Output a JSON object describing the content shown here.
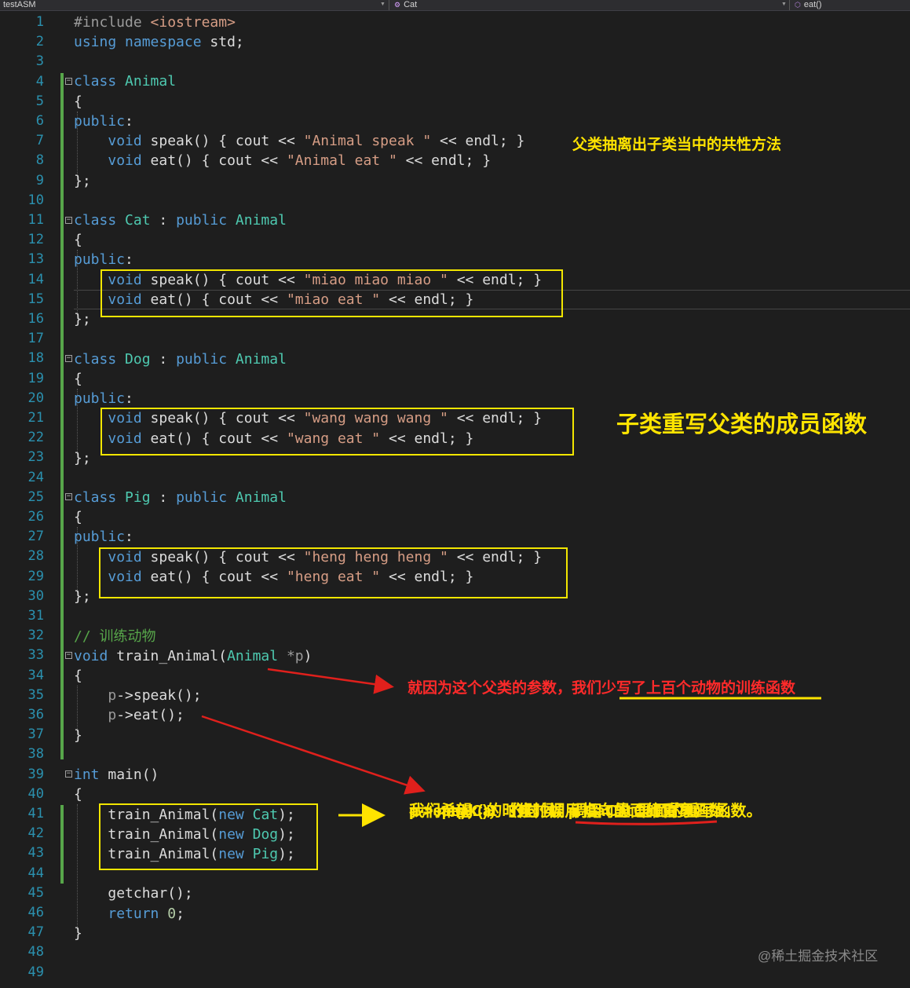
{
  "navbar": {
    "project": "testASM",
    "scope_icon": "class-icon",
    "scope": "Cat",
    "member_icon": "method-icon",
    "member": "eat()"
  },
  "line_numbers": [
    "1",
    "2",
    "3",
    "4",
    "5",
    "6",
    "7",
    "8",
    "9",
    "10",
    "11",
    "12",
    "13",
    "14",
    "15",
    "16",
    "17",
    "18",
    "19",
    "20",
    "21",
    "22",
    "23",
    "24",
    "25",
    "26",
    "27",
    "28",
    "29",
    "30",
    "31",
    "32",
    "33",
    "34",
    "35",
    "36",
    "37",
    "38",
    "39",
    "40",
    "41",
    "42",
    "43",
    "44",
    "45",
    "46",
    "47",
    "48",
    "49"
  ],
  "code": {
    "l1": {
      "a": "#include ",
      "b": "<iostream>"
    },
    "l2": {
      "a": "using namespace ",
      "b": "std;"
    },
    "l4": {
      "a": "class ",
      "b": "Animal"
    },
    "l5": {
      "a": "{"
    },
    "l6": {
      "a": "public",
      ":": ":"
    },
    "l7": {
      "a": "void ",
      "b": "speak() { cout << ",
      "c": "\"Animal speak \"",
      "d": " << endl; }"
    },
    "l8": {
      "a": "void ",
      "b": "eat() { cout << ",
      "c": "\"Animal eat \"",
      "d": " << endl; }"
    },
    "l9": {
      "a": "};"
    },
    "l11": {
      "a": "class ",
      "b": "Cat",
      "c": " : ",
      "d": "public ",
      "e": "Animal"
    },
    "l12": {
      "a": "{"
    },
    "l13": {
      "a": "public",
      ":": ":"
    },
    "l14": {
      "a": "void ",
      "b": "speak() { cout << ",
      "c": "\"miao miao miao \"",
      "d": " << endl; }"
    },
    "l15": {
      "a": "void ",
      "b": "eat() { cout << ",
      "c": "\"miao eat \"",
      "d": " << endl; }"
    },
    "l16": {
      "a": "};"
    },
    "l18": {
      "a": "class ",
      "b": "Dog",
      "c": " : ",
      "d": "public ",
      "e": "Animal"
    },
    "l19": {
      "a": "{"
    },
    "l20": {
      "a": "public",
      ":": ":"
    },
    "l21": {
      "a": "void ",
      "b": "speak() { cout << ",
      "c": "\"wang wang wang \"",
      "d": " << endl; }"
    },
    "l22": {
      "a": "void ",
      "b": "eat() { cout << ",
      "c": "\"wang eat \"",
      "d": " << endl; }"
    },
    "l23": {
      "a": "};"
    },
    "l25": {
      "a": "class ",
      "b": "Pig",
      "c": " : ",
      "d": "public ",
      "e": "Animal"
    },
    "l26": {
      "a": "{"
    },
    "l27": {
      "a": "public",
      ":": ":"
    },
    "l28": {
      "a": "void ",
      "b": "speak() { cout << ",
      "c": "\"heng heng heng \"",
      "d": " << endl; }"
    },
    "l29": {
      "a": "void ",
      "b": "eat() { cout << ",
      "c": "\"heng eat \"",
      "d": " << endl; }"
    },
    "l30": {
      "a": "};"
    },
    "l32": {
      "a": "// 训练动物"
    },
    "l33": {
      "a": "void ",
      "b": "train_Animal(",
      "c": "Animal ",
      "d": "*p",
      ")": ")"
    },
    "l34": {
      "a": "{"
    },
    "l35": {
      "a": "p",
      "b": "->speak();"
    },
    "l36": {
      "a": "p",
      "b": "->eat();"
    },
    "l37": {
      "a": "}"
    },
    "l39": {
      "a": "int ",
      "b": "main()"
    },
    "l40": {
      "a": "{"
    },
    "l41": {
      "a": "train_Animal(",
      "b": "new ",
      "c": "Cat",
      ")": ");"
    },
    "l42": {
      "a": "train_Animal(",
      "b": "new ",
      "c": "Dog",
      ")": ");"
    },
    "l43": {
      "a": "train_Animal(",
      "b": "new ",
      "c": "Pig",
      ")": ");"
    },
    "l45": {
      "a": "getchar();"
    },
    "l46": {
      "a": "return ",
      "b": "0",
      ";": ";"
    },
    "l47": {
      "a": "}"
    }
  },
  "annotations": {
    "parent_extract": "父类抽离出子类当中的共性方法",
    "override": "子类重写父类的成员函数",
    "param_note": "就因为这个父类的参数，我们少写了上百个动物的训练函数",
    "explain": [
      "p = new Cat （这时候 p 指向的 Cat 对象）",
      "我们希望:",
      "p->speak()； 的时候，调用 Cat 里面的重写函数。",
      "p->eat()； 的时候，调用 Cat 里面的重写函数。"
    ]
  },
  "colors": {
    "background": "#1e1e1e",
    "keyword": "#569cd6",
    "type": "#4ec9b0",
    "string": "#d69d85",
    "comment": "#57a64a",
    "line_number": "#2b91af",
    "annotation_yellow": "#ffe400",
    "annotation_red": "#ff2a2a"
  },
  "watermark": "@稀土掘金技术社区"
}
